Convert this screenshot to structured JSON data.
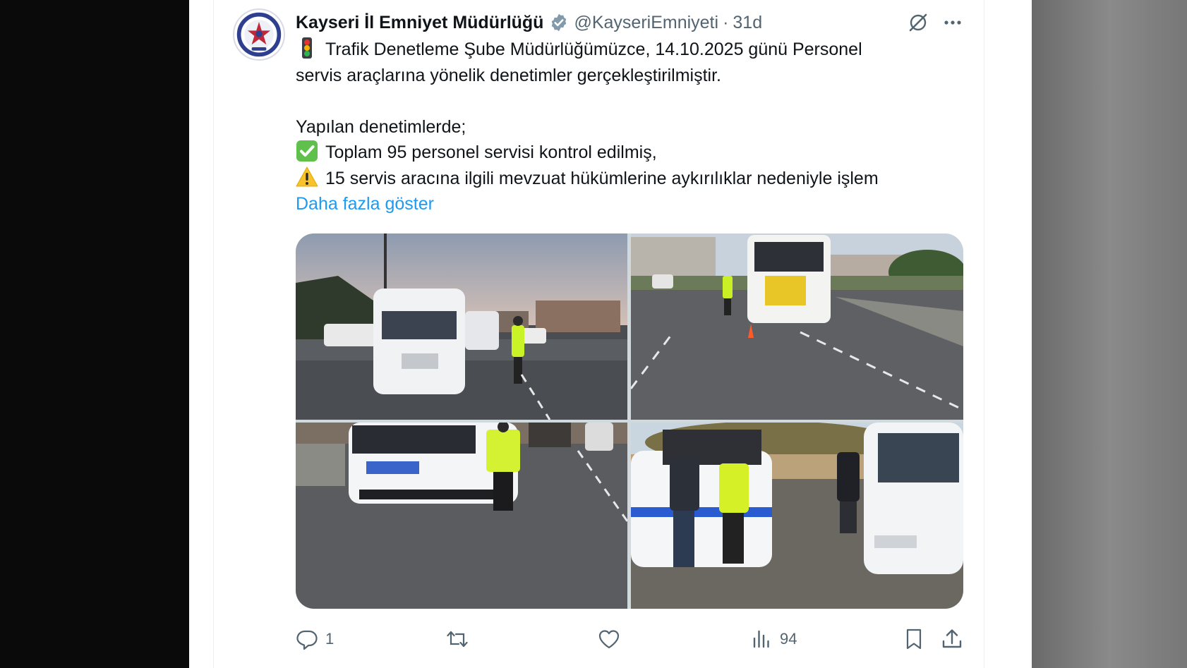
{
  "tweet": {
    "author_name": "Kayseri İl Emniyet Müdürlüğü",
    "handle": "@KayseriEmniyeti",
    "separator": "·",
    "time": "31d",
    "lines": [
      "Trafik Denetleme Şube Müdürlüğümüzce, 14.10.2025 günü Personel",
      "servis araçlarına yönelik denetimler gerçekleştirilmiştir.",
      "Yapılan denetimlerde;",
      "Toplam 95 personel servisi kontrol edilmiş,",
      "15 servis aracına ilgili mevzuat hükümlerine aykırılıklar nedeniyle işlem"
    ],
    "show_more": "Daha fazla göster",
    "icons": {
      "traffic_light": "traffic-light-emoji",
      "check": "check-mark-emoji",
      "warning": "warning-emoji"
    }
  },
  "actions": {
    "replies": "1",
    "views": "94"
  },
  "colors": {
    "link": "#1d9bf0",
    "secondary_text": "#536471",
    "primary_text": "#0f1419",
    "verified_badge": "#829aab"
  }
}
